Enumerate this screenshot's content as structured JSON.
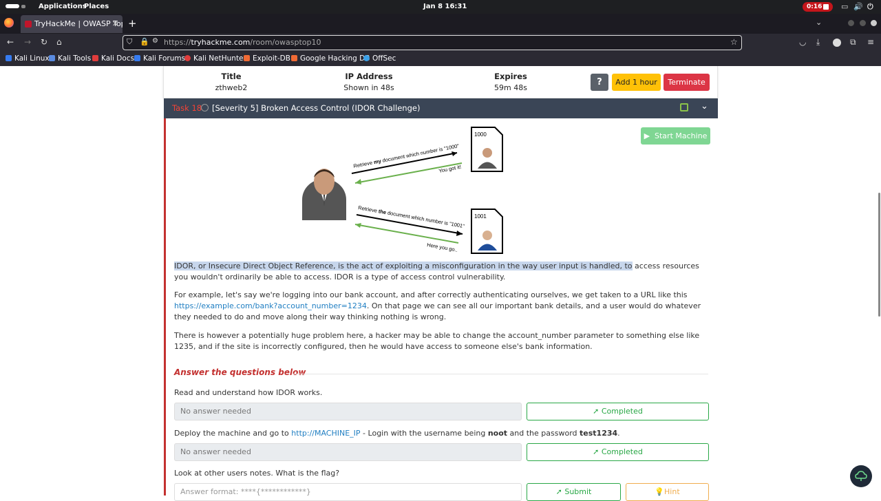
{
  "os": {
    "apps": "Applications",
    "places": "Places",
    "clock": "Jan 8  16:31",
    "rec": "0:16"
  },
  "browser": {
    "tab_title": "TryHackMe | OWASP Top",
    "url_prefix": "https://",
    "url_domain": "tryhackme.com",
    "url_path": "/room/owasptop10",
    "bookmarks": [
      "Kali Linux",
      "Kali Tools",
      "Kali Docs",
      "Kali Forums",
      "Kali NetHunter",
      "Exploit-DB",
      "Google Hacking DB",
      "OffSec"
    ]
  },
  "machine": {
    "title_label": "Title",
    "title_value": "zthweb2",
    "ip_label": "IP Address",
    "ip_value": "Shown in 48s",
    "expires_label": "Expires",
    "expires_value": "59m 48s",
    "help": "?",
    "add": "Add 1 hour",
    "terminate": "Terminate"
  },
  "task": {
    "number": "Task 18",
    "title": "[Severity 5] Broken Access Control (IDOR Challenge)",
    "start_machine": "Start Machine",
    "diagram": {
      "doc1": "1000",
      "doc2": "1001",
      "req1_a": "Retrieve ",
      "req1_b": "my",
      "req1_c": " document which number is \"1000\"",
      "resp1": "You got it!",
      "req2_a": "Retrieve ",
      "req2_b": "the",
      "req2_c": " document which number is \"1001\"",
      "resp2": "Here you go.."
    },
    "p1_highlight": "IDOR, or Insecure Direct Object Reference, is the act of exploiting a misconfiguration in the way user input is handled, to",
    "p1_rest": " access resources you wouldn't ordinarily be able to access. IDOR is a type of access control vulnerability.",
    "p2_a": "For example, let's say we're logging into our bank account, and after correctly authenticating ourselves, we get taken to a URL like this ",
    "p2_link": "https://example.com/bank?account_number=1234",
    "p2_b": ". On that page we can see all our important bank details, and a user would do whatever they needed to do and move along their way thinking nothing is wrong.",
    "p3": "There is however a potentially huge problem here, a hacker may be able to change the account_number parameter to something else like 1235, and if the site is incorrectly configured, then he would have access to someone else's bank information.",
    "answers_heading": "Answer the questions below",
    "q1": "Read and understand how IDOR works.",
    "q1_field": "No answer needed",
    "q1_status": "Completed",
    "q2_a": "Deploy the machine and go to ",
    "q2_link": "http://MACHINE_IP",
    "q2_b": " - Login with the username being ",
    "q2_user": "noot",
    "q2_c": " and the password ",
    "q2_pass": "test1234",
    "q2_d": ".",
    "q2_field": "No answer needed",
    "q2_status": "Completed",
    "q3": "Look at other users notes. What is the flag?",
    "q3_placeholder": "Answer format: ****{************}",
    "submit": "Submit",
    "hint": "Hint"
  }
}
